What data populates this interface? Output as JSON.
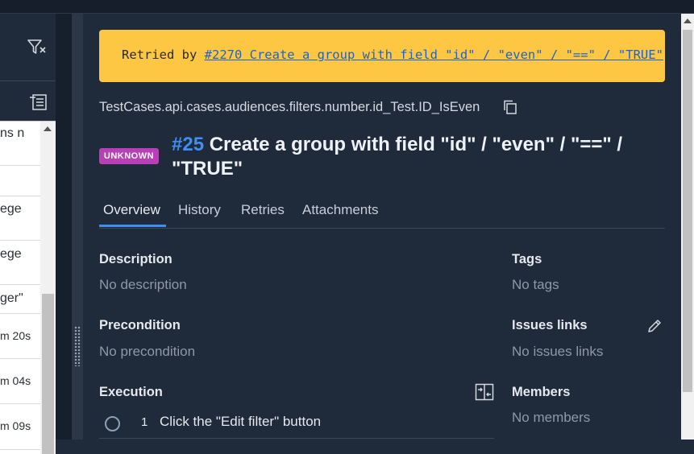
{
  "left_panel": {
    "list_items": [
      "ns n",
      "ege",
      "ege",
      "ger\"",
      "m 20s",
      "m 04s",
      "m 09s"
    ]
  },
  "banner": {
    "prefix": "Retried by ",
    "link": "#2270 Create a group with field \"id\" / \"even\" / \"==\" / \"TRUE\""
  },
  "test": {
    "path": "TestCases.api.cases.audiences.filters.number.id_Test.ID_IsEven",
    "status": "UNKNOWN",
    "number": "#25",
    "title": "Create a group with field \"id\" / \"even\" / \"==\" / \"TRUE\""
  },
  "tabs": [
    "Overview",
    "History",
    "Retries",
    "Attachments"
  ],
  "sections": {
    "description": {
      "label": "Description",
      "value": "No description"
    },
    "precondition": {
      "label": "Precondition",
      "value": "No precondition"
    },
    "execution": {
      "label": "Execution"
    },
    "tags": {
      "label": "Tags",
      "value": "No tags"
    },
    "issues": {
      "label": "Issues links",
      "value": "No issues links"
    },
    "members": {
      "label": "Members",
      "value": "No members"
    }
  },
  "steps": [
    {
      "number": "1",
      "text": "Click the \"Edit filter\" button"
    }
  ],
  "colors": {
    "background": "#1f2a3a",
    "banner": "#fdc743",
    "accent": "#3d8ef5",
    "status_unknown": "#b93fb6"
  }
}
